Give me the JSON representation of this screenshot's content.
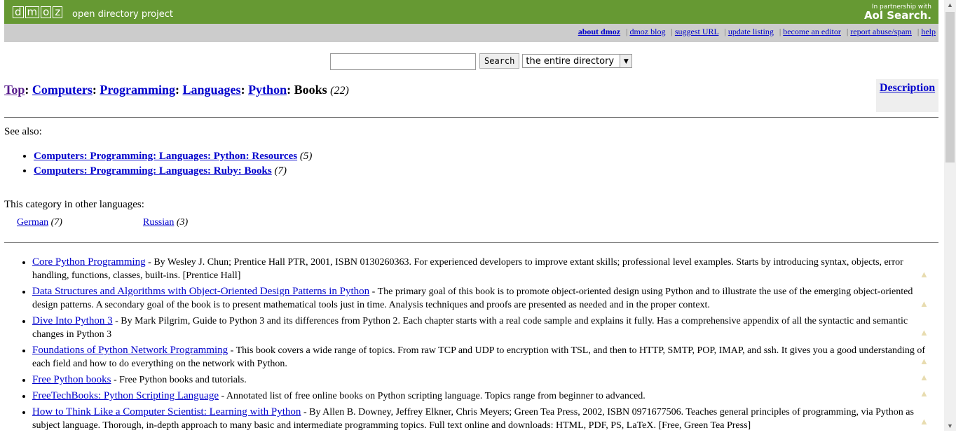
{
  "header": {
    "logo_letters": [
      "d",
      "m",
      "o",
      "z"
    ],
    "tagline": "open directory project",
    "partner_text": "In partnership with",
    "partner_brand": "Aol Search."
  },
  "toplinks": [
    "about dmoz",
    "dmoz blog",
    "suggest URL",
    "update listing",
    "become an editor",
    "report abuse/spam",
    "help"
  ],
  "search": {
    "value": "",
    "button": "Search",
    "scope": "the entire directory"
  },
  "breadcrumb": {
    "items": [
      "Top",
      "Computers",
      "Programming",
      "Languages",
      "Python"
    ],
    "current": "Books",
    "count": "(22)"
  },
  "description_link": "Description",
  "see_also": {
    "label": "See also:",
    "items": [
      {
        "label": "Computers: Programming: Languages: Python: Resources",
        "count": "(5)"
      },
      {
        "label": "Computers: Programming: Languages: Ruby: Books",
        "count": "(7)"
      }
    ]
  },
  "other_languages": {
    "label": "This category in other languages:",
    "items": [
      {
        "label": "German",
        "count": "(7)"
      },
      {
        "label": "Russian",
        "count": "(3)"
      }
    ]
  },
  "listings": [
    {
      "title": "Core Python Programming",
      "desc": " - By Wesley J. Chun; Prentice Hall PTR, 2001, ISBN 0130260363. For experienced developers to improve extant skills; professional level examples. Starts by introducing syntax, objects, error handling, functions, classes, built-ins. [Prentice Hall]"
    },
    {
      "title": "Data Structures and Algorithms with Object-Oriented Design Patterns in Python",
      "desc": " - The primary goal of this book is to promote object-oriented design using Python and to illustrate the use of the emerging object-oriented design patterns. A secondary goal of the book is to present mathematical tools just in time. Analysis techniques and proofs are presented as needed and in the proper context."
    },
    {
      "title": "Dive Into Python 3",
      "desc": " - By Mark Pilgrim, Guide to Python 3 and its differences from Python 2. Each chapter starts with a real code sample and explains it fully. Has a comprehensive appendix of all the syntactic and semantic changes in Python 3"
    },
    {
      "title": "Foundations of Python Network Programming",
      "desc": " - This book covers a wide range of topics. From raw TCP and UDP to encryption with TSL, and then to HTTP, SMTP, POP, IMAP, and ssh. It gives you a good understanding of each field and how to do everything on the network with Python."
    },
    {
      "title": "Free Python books",
      "desc": " - Free Python books and tutorials."
    },
    {
      "title": "FreeTechBooks: Python Scripting Language",
      "desc": " - Annotated list of free online books on Python scripting language. Topics range from beginner to advanced."
    },
    {
      "title": "How to Think Like a Computer Scientist: Learning with Python",
      "desc": " - By Allen B. Downey, Jeffrey Elkner, Chris Meyers; Green Tea Press, 2002, ISBN 0971677506. Teaches general principles of programming, via Python as subject language. Thorough, in-depth approach to many basic and intermediate programming topics. Full text online and downloads: HTML, PDF, PS, LaTeX. [Free, Green Tea Press]"
    }
  ]
}
